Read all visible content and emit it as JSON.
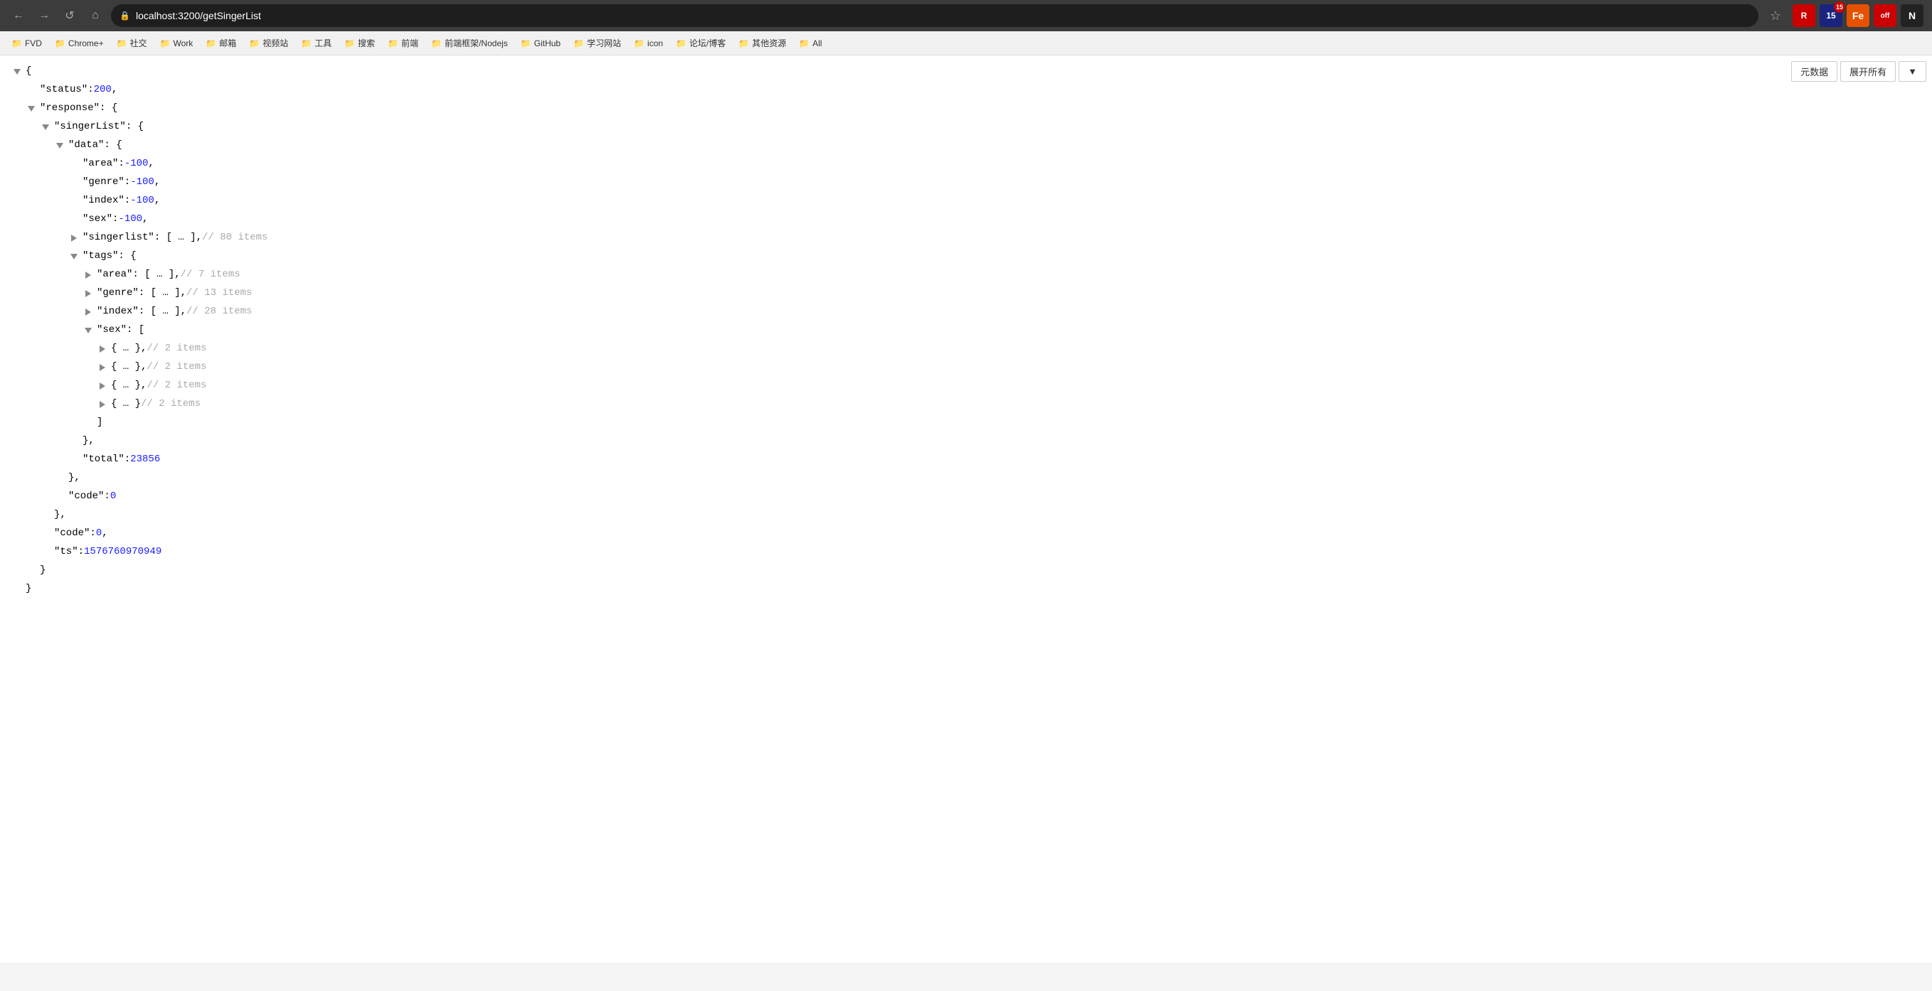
{
  "browser": {
    "url": "localhost:3200/getSingerList",
    "nav_buttons": {
      "back": "←",
      "forward": "→",
      "refresh": "↺",
      "home": "⌂"
    },
    "extensions": [
      {
        "id": "ext-1",
        "label": "R",
        "style": "ext-red"
      },
      {
        "id": "ext-2",
        "label": "15",
        "style": "ext-blue-dark",
        "badge": "15"
      },
      {
        "id": "ext-3",
        "label": "Fe",
        "style": "ext-orange"
      },
      {
        "id": "ext-4",
        "label": "off",
        "style": "ext-red-off"
      },
      {
        "id": "ext-5",
        "label": "N",
        "style": "ext-black"
      }
    ],
    "bookmarks": [
      {
        "label": "FVD",
        "icon": "📁"
      },
      {
        "label": "Chrome+",
        "icon": "📁"
      },
      {
        "label": "社交",
        "icon": "📁"
      },
      {
        "label": "Work",
        "icon": "📁"
      },
      {
        "label": "邮箱",
        "icon": "📁"
      },
      {
        "label": "视频站",
        "icon": "📁"
      },
      {
        "label": "工具",
        "icon": "📁"
      },
      {
        "label": "搜索",
        "icon": "📁"
      },
      {
        "label": "前端",
        "icon": "📁"
      },
      {
        "label": "前端框架/Nodejs",
        "icon": "📁"
      },
      {
        "label": "GitHub",
        "icon": "📁"
      },
      {
        "label": "学习网站",
        "icon": "📁"
      },
      {
        "label": "icon",
        "icon": "📁"
      },
      {
        "label": "论坛/博客",
        "icon": "📁"
      },
      {
        "label": "其他资源",
        "icon": "📁"
      },
      {
        "label": "All",
        "icon": "📁"
      }
    ]
  },
  "json_toolbar": {
    "meta_btn": "元数据",
    "expand_btn": "展开所有"
  },
  "json_data": {
    "status": 200,
    "response": {
      "singerList": {
        "data": {
          "area": -100,
          "genre": -100,
          "index": -100,
          "sex": -100,
          "singerlist_count": 80,
          "tags": {
            "area_count": 7,
            "genre_count": 13,
            "index_count": 28,
            "sex": [
              {
                "items": 2
              },
              {
                "items": 2
              },
              {
                "items": 2
              },
              {
                "items": 2
              }
            ]
          },
          "total": 23856
        },
        "code": 0
      },
      "code": 0,
      "ts": 1576760970949
    }
  }
}
